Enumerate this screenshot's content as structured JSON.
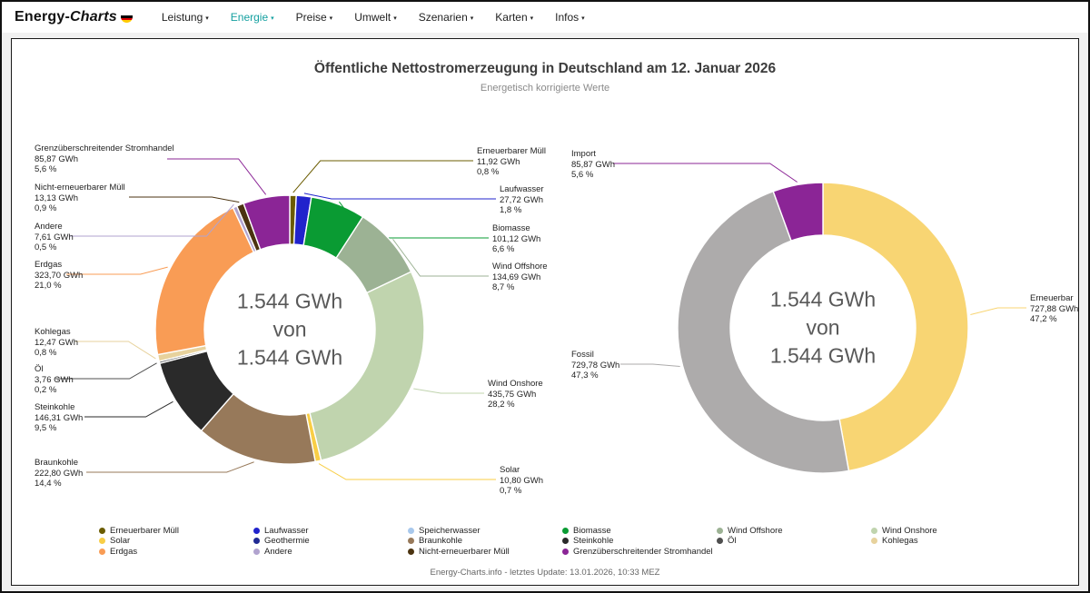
{
  "header": {
    "logo": {
      "part1": "Energy-",
      "part2": "Charts"
    },
    "nav": [
      {
        "label": "Leistung",
        "active": false
      },
      {
        "label": "Energie",
        "active": true
      },
      {
        "label": "Preise",
        "active": false
      },
      {
        "label": "Umwelt",
        "active": false
      },
      {
        "label": "Szenarien",
        "active": false
      },
      {
        "label": "Karten",
        "active": false
      },
      {
        "label": "Infos",
        "active": false
      }
    ]
  },
  "page": {
    "title": "Öffentliche Nettostromerzeugung in Deutschland am 12. Januar 2026",
    "subtitle": "Energetisch korrigierte Werte",
    "footer": "Energy-Charts.info - letztes Update: 13.01.2026, 10:33 MEZ"
  },
  "chart_data": [
    {
      "type": "pie",
      "subtype": "donut",
      "center_text": [
        "1.544 GWh",
        "von",
        "1.544 GWh"
      ],
      "slices": [
        {
          "name": "Erneuerbarer Müll",
          "value_gwh": 11.92,
          "value_label": "11,92 GWh",
          "percent_label": "0,8 %",
          "color": "#6b5c00"
        },
        {
          "name": "Laufwasser",
          "value_gwh": 27.72,
          "value_label": "27,72 GWh",
          "percent_label": "1,8 %",
          "color": "#2123cc"
        },
        {
          "name": "Biomasse",
          "value_gwh": 101.12,
          "value_label": "101,12 GWh",
          "percent_label": "6,6 %",
          "color": "#0a9b33"
        },
        {
          "name": "Wind Offshore",
          "value_gwh": 134.69,
          "value_label": "134,69 GWh",
          "percent_label": "8,7 %",
          "color": "#9cb294"
        },
        {
          "name": "Wind Onshore",
          "value_gwh": 435.75,
          "value_label": "435,75 GWh",
          "percent_label": "28,2 %",
          "color": "#c0d4ae"
        },
        {
          "name": "Solar",
          "value_gwh": 10.8,
          "value_label": "10,80 GWh",
          "percent_label": "0,7 %",
          "color": "#f8ce46"
        },
        {
          "name": "Braunkohle",
          "value_gwh": 222.8,
          "value_label": "222,80 GWh",
          "percent_label": "14,4 %",
          "color": "#97795a"
        },
        {
          "name": "Steinkohle",
          "value_gwh": 146.31,
          "value_label": "146,31 GWh",
          "percent_label": "9,5 %",
          "color": "#2a2a2a"
        },
        {
          "name": "Öl",
          "value_gwh": 3.76,
          "value_label": "3,76 GWh",
          "percent_label": "0,2 %",
          "color": "#4f4f4f"
        },
        {
          "name": "Kohlegas",
          "value_gwh": 12.47,
          "value_label": "12,47 GWh",
          "percent_label": "0,8 %",
          "color": "#e7d29d"
        },
        {
          "name": "Erdgas",
          "value_gwh": 323.7,
          "value_label": "323,70 GWh",
          "percent_label": "21,0 %",
          "color": "#f99c55"
        },
        {
          "name": "Andere",
          "value_gwh": 7.61,
          "value_label": "7,61 GWh",
          "percent_label": "0,5 %",
          "color": "#b1a3cf"
        },
        {
          "name": "Nicht-erneuerbarer Müll",
          "value_gwh": 13.13,
          "value_label": "13,13 GWh",
          "percent_label": "0,9 %",
          "color": "#4b3310"
        },
        {
          "name": "Grenzüberschreitender Stromhandel",
          "value_gwh": 85.87,
          "value_label": "85,87 GWh",
          "percent_label": "5,6 %",
          "color": "#8b2596"
        }
      ]
    },
    {
      "type": "pie",
      "subtype": "donut",
      "center_text": [
        "1.544 GWh",
        "von",
        "1.544 GWh"
      ],
      "slices": [
        {
          "name": "Erneuerbar",
          "value_gwh": 727.88,
          "value_label": "727,88 GWh",
          "percent_label": "47,2 %",
          "color": "#f8d573"
        },
        {
          "name": "Fossil",
          "value_gwh": 729.78,
          "value_label": "729,78 GWh",
          "percent_label": "47,3 %",
          "color": "#adabab"
        },
        {
          "name": "Import",
          "value_gwh": 85.87,
          "value_label": "85,87 GWh",
          "percent_label": "5,6 %",
          "color": "#8b2596"
        }
      ]
    }
  ],
  "legend": {
    "columns": [
      [
        {
          "label": "Erneuerbarer Müll",
          "color": "#6b5c00"
        },
        {
          "label": "Solar",
          "color": "#f8ce46"
        },
        {
          "label": "Erdgas",
          "color": "#f99c55"
        }
      ],
      [
        {
          "label": "Laufwasser",
          "color": "#2123cc"
        },
        {
          "label": "Geothermie",
          "color": "#202a94"
        },
        {
          "label": "Andere",
          "color": "#b1a3cf"
        }
      ],
      [
        {
          "label": "Speicherwasser",
          "color": "#a8c8ec"
        },
        {
          "label": "Braunkohle",
          "color": "#97795a"
        },
        {
          "label": "Nicht-erneuerbarer Müll",
          "color": "#4b3310"
        }
      ],
      [
        {
          "label": "Biomasse",
          "color": "#0a9b33"
        },
        {
          "label": "Steinkohle",
          "color": "#2a2a2a"
        },
        {
          "label": "Grenzüberschreitender Stromhandel",
          "color": "#8b2596"
        }
      ],
      [
        {
          "label": "Wind Offshore",
          "color": "#9cb294"
        },
        {
          "label": "Öl",
          "color": "#4f4f4f"
        }
      ],
      [
        {
          "label": "Wind Onshore",
          "color": "#c0d4ae"
        },
        {
          "label": "Kohlegas",
          "color": "#e7d29d"
        }
      ]
    ]
  }
}
